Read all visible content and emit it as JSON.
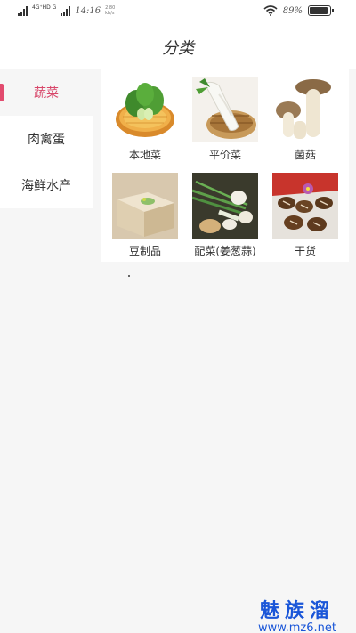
{
  "status_bar": {
    "network_label": "4G⁺HD G",
    "time": "14:16",
    "speed": "2.80 kb/s",
    "battery_text": "89%",
    "battery_level": 0.89
  },
  "header": {
    "title": "分类"
  },
  "sidebar": {
    "items": [
      {
        "label": "蔬菜",
        "active": true
      },
      {
        "label": "肉禽蛋",
        "active": false
      },
      {
        "label": "海鲜水产",
        "active": false
      }
    ]
  },
  "grid": {
    "items": [
      {
        "label": "本地菜",
        "icon": "bok-choy-image"
      },
      {
        "label": "平价菜",
        "icon": "radish-image"
      },
      {
        "label": "菌菇",
        "icon": "mushroom-image"
      },
      {
        "label": "豆制品",
        "icon": "tofu-image"
      },
      {
        "label": "配菜(姜葱蒜)",
        "icon": "scallion-garlic-image"
      },
      {
        "label": "干货",
        "icon": "dried-goods-image"
      }
    ]
  },
  "watermark": {
    "chinese": "魅族溜",
    "url": "www.mz6.net"
  },
  "colors": {
    "accent": "#e24b6e",
    "watermark": "#1a56d8",
    "background": "#f6f6f6"
  }
}
